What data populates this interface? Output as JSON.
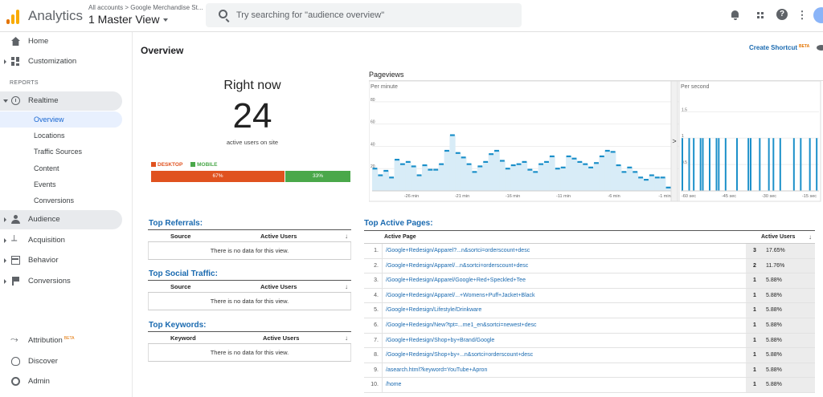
{
  "app": {
    "title": "Analytics",
    "account_crumb": "All accounts > Google Merchandise St...",
    "view_name": "1 Master View"
  },
  "search": {
    "placeholder": "Try searching for \"audience overview\""
  },
  "topbar_icons": [
    "notifications-icon",
    "apps-icon",
    "help-icon",
    "more-vert-icon",
    "account-avatar"
  ],
  "sidebar": {
    "home": "Home",
    "customization": "Customization",
    "reports_label": "REPORTS",
    "realtime": "Realtime",
    "realtime_items": [
      "Overview",
      "Locations",
      "Traffic Sources",
      "Content",
      "Events",
      "Conversions"
    ],
    "audience": "Audience",
    "acquisition": "Acquisition",
    "behavior": "Behavior",
    "conversions": "Conversions",
    "attribution": "Attribution",
    "attribution_badge": "BETA",
    "discover": "Discover",
    "admin": "Admin"
  },
  "main": {
    "title": "Overview",
    "create_shortcut": "Create Shortcut",
    "create_shortcut_badge": "BETA",
    "right_now": {
      "title": "Right now",
      "count": "24",
      "subtitle": "active users on site",
      "legend_desktop": "DESKTOP",
      "legend_mobile": "MOBILE",
      "desktop_pct": "67%",
      "mobile_pct": "33%",
      "desktop_share": 0.67,
      "mobile_share": 0.33,
      "desktop_color": "#e0521f",
      "mobile_color": "#4aa84a"
    },
    "pageviews": {
      "title": "Pageviews",
      "per_minute_label": "Per minute",
      "per_second_label": "Per second",
      "per_minute_y_ticks": [
        "80",
        "60",
        "40",
        "20"
      ],
      "per_minute_x_ticks": [
        "-26 min",
        "-21 min",
        "-16 min",
        "-11 min",
        "-6 min",
        "-1 min"
      ],
      "per_second_y_ticks": [
        "1.5",
        "1",
        "0.5"
      ],
      "per_second_x_ticks": [
        "-60 sec",
        "-45 sec",
        "-30 sec",
        "-15 sec"
      ],
      "expand_arrow": ">"
    },
    "top_referrals": {
      "title": "Top Referrals:",
      "col_source": "Source",
      "col_users": "Active Users",
      "empty": "There is no data for this view."
    },
    "top_social": {
      "title": "Top Social Traffic:",
      "col_source": "Source",
      "col_users": "Active Users",
      "empty": "There is no data for this view."
    },
    "top_keywords": {
      "title": "Top Keywords:",
      "col_keyword": "Keyword",
      "col_users": "Active Users",
      "empty": "There is no data for this view."
    },
    "top_pages": {
      "title": "Top Active Pages:",
      "col_page": "Active Page",
      "col_users": "Active Users",
      "rows": [
        {
          "num": "1.",
          "url": "/Google+Redesign/Apparel?...n&sortci=orderscount+desc",
          "users": "3",
          "pct": "17.65%"
        },
        {
          "num": "2.",
          "url": "/Google+Redesign/Apparel/...n&sortci=orderscount+desc",
          "users": "2",
          "pct": "11.76%"
        },
        {
          "num": "3.",
          "url": "/Google+Redesign/Apparel/Google+Red+Speckled+Tee",
          "users": "1",
          "pct": "5.88%"
        },
        {
          "num": "4.",
          "url": "/Google+Redesign/Apparel/...+Womens+Puff+Jacket+Black",
          "users": "1",
          "pct": "5.88%"
        },
        {
          "num": "5.",
          "url": "/Google+Redesign/Lifestyle/Drinkware",
          "users": "1",
          "pct": "5.88%"
        },
        {
          "num": "6.",
          "url": "/Google+Redesign/New?tpt=...me1_en&sortci=newest+desc",
          "users": "1",
          "pct": "5.88%"
        },
        {
          "num": "7.",
          "url": "/Google+Redesign/Shop+by+Brand/Google",
          "users": "1",
          "pct": "5.88%"
        },
        {
          "num": "8.",
          "url": "/Google+Redesign/Shop+by+...n&sortci=orderscount+desc",
          "users": "1",
          "pct": "5.88%"
        },
        {
          "num": "9.",
          "url": "/asearch.html?keyword=YouTube+Apron",
          "users": "1",
          "pct": "5.88%"
        },
        {
          "num": "10.",
          "url": "/home",
          "users": "1",
          "pct": "5.88%"
        }
      ]
    }
  },
  "chart_data": [
    {
      "type": "bar",
      "title": "Per minute",
      "ylim": [
        0,
        90
      ],
      "x_tick_labels": [
        "-26 min",
        "-21 min",
        "-16 min",
        "-11 min",
        "-6 min",
        "-1 min"
      ],
      "values": [
        20,
        14,
        18,
        12,
        28,
        24,
        26,
        22,
        14,
        23,
        19,
        19,
        24,
        36,
        50,
        34,
        30,
        24,
        17,
        22,
        26,
        33,
        36,
        27,
        20,
        23,
        24,
        26,
        19,
        17,
        24,
        26,
        31,
        20,
        21,
        31,
        29,
        26,
        24,
        21,
        25,
        31,
        36,
        35,
        23,
        17,
        21,
        17,
        12,
        10,
        14,
        12,
        12,
        3
      ],
      "grid": true
    },
    {
      "type": "bar",
      "title": "Per second",
      "ylim": [
        0,
        1.9
      ],
      "x_tick_labels": [
        "-60 sec",
        "-45 sec",
        "-30 sec",
        "-15 sec"
      ],
      "values": [
        1,
        0,
        0,
        1,
        0,
        1,
        0,
        0,
        1,
        1,
        0,
        0,
        1,
        0,
        0,
        1,
        1,
        0,
        0,
        1,
        0,
        0,
        0,
        0,
        1,
        0,
        0,
        0,
        0,
        1,
        1,
        0,
        0,
        0,
        1,
        0,
        0,
        0,
        1,
        0,
        1,
        0,
        0,
        1,
        0,
        0,
        0,
        0,
        0,
        1,
        0,
        0,
        1,
        0,
        0,
        0,
        1,
        0,
        0,
        1
      ],
      "grid": true
    }
  ]
}
